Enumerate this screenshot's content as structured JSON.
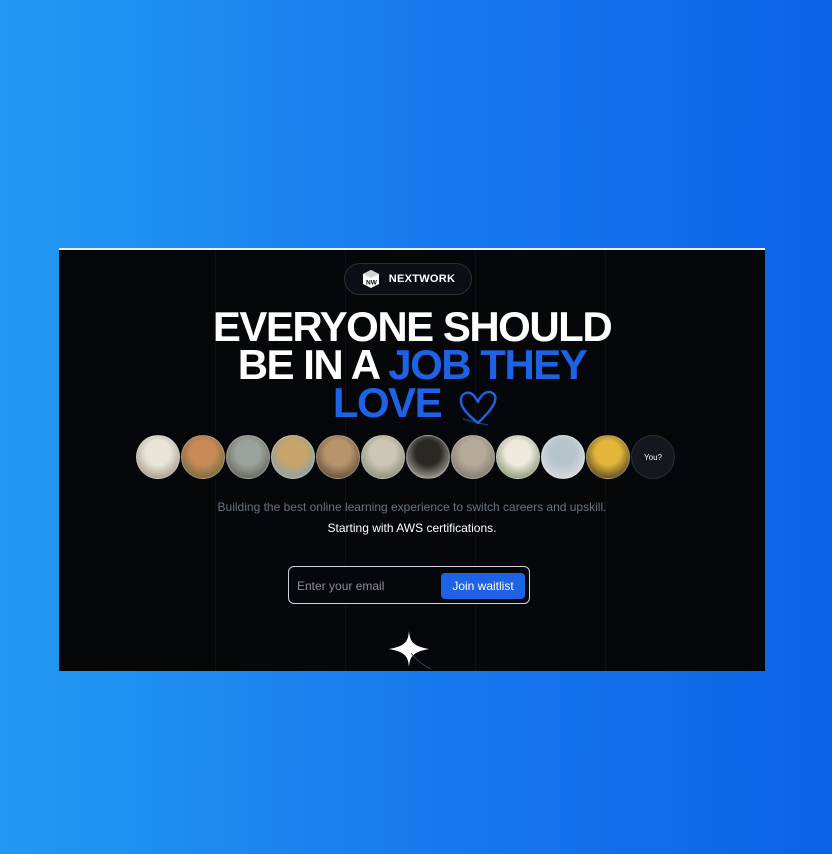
{
  "brand": {
    "name": "NEXTWORK",
    "logo_icon": "nw-cube-logo"
  },
  "headline": {
    "line1": "EVERYONE SHOULD",
    "line2_white": "BE IN A ",
    "line2_blue": "JOB THEY",
    "line3_blue": "LOVE",
    "accent_color": "#1e63e6"
  },
  "avatars": [
    {
      "name": "alpaca-avatar",
      "colors": [
        "#e9e3d8",
        "#8b7f6e"
      ]
    },
    {
      "name": "fox-avatar",
      "colors": [
        "#c98a58",
        "#4d5c35"
      ]
    },
    {
      "name": "koala-avatar",
      "colors": [
        "#9aa39b",
        "#4a4f48"
      ]
    },
    {
      "name": "giraffe-avatar",
      "colors": [
        "#c7a46a",
        "#6fa0c8"
      ]
    },
    {
      "name": "cat-avatar",
      "colors": [
        "#b8946b",
        "#3d342b"
      ]
    },
    {
      "name": "sheep-avatar",
      "colors": [
        "#cdc6b5",
        "#6e7a5d"
      ]
    },
    {
      "name": "pug-avatar",
      "colors": [
        "#2a2825",
        "#d9d4cc"
      ]
    },
    {
      "name": "seal-avatar",
      "colors": [
        "#b5aa98",
        "#6b655c"
      ]
    },
    {
      "name": "llama-avatar",
      "colors": [
        "#eee8dd",
        "#5f7b4b"
      ]
    },
    {
      "name": "pineapple-avatar",
      "colors": [
        "#b8c4cc",
        "#e5e7ea"
      ]
    },
    {
      "name": "dog-avatar",
      "colors": [
        "#e3b53a",
        "#1b1b1b"
      ]
    }
  ],
  "you_label": "You?",
  "subtitle_line1": "Building the best online learning experience to switch careers and upskill.",
  "subtitle_line2": "Starting with AWS certifications.",
  "email_placeholder": "Enter your email",
  "join_button_label": "Join waitlist",
  "sparkle_icon": "sparkle-icon",
  "heart_icon": "heart-outline-icon"
}
